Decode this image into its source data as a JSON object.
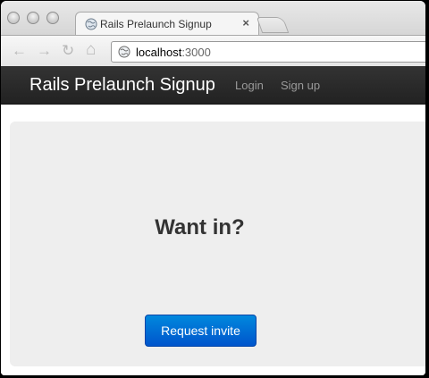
{
  "browser": {
    "tab_title": "Rails Prelaunch Signup",
    "tab_close": "×",
    "url_host": "localhost",
    "url_port": ":3000",
    "icons": {
      "back": "←",
      "forward": "→",
      "reload": "↻",
      "home": "⌂"
    }
  },
  "navbar": {
    "brand": "Rails Prelaunch Signup",
    "links": [
      "Login",
      "Sign up"
    ]
  },
  "hero": {
    "title": "Want in?",
    "button_label": "Request invite"
  },
  "colors": {
    "navbar_bg": "#222222",
    "hero_bg": "#eeeeee",
    "button_primary": "#0066cc"
  }
}
